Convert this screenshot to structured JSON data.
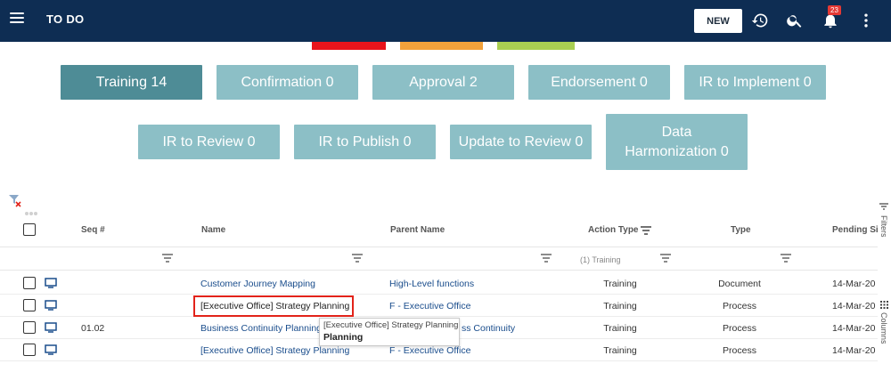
{
  "header": {
    "title": "TO DO",
    "new_button": "NEW",
    "notification_count": "23"
  },
  "status_colors": [
    "#e8141c",
    "#f2a23b",
    "#a9cf52"
  ],
  "tiles": {
    "row1": [
      "Training 14",
      "Confirmation 0",
      "Approval 2",
      "Endorsement 0",
      "IR to Implement 0"
    ],
    "row2": [
      "IR to Review 0",
      "IR to Publish 0",
      "Update to Review 0",
      "Data Harmonization 0"
    ]
  },
  "grid": {
    "columns": [
      "Seq #",
      "Name",
      "Parent Name",
      "Action Type",
      "Type",
      "Pending Sin"
    ],
    "action_type_filter": "(1) Training",
    "rows": [
      {
        "seq": "",
        "name": "Customer Journey Mapping",
        "parent": "High-Level functions",
        "action": "Training",
        "type": "Document",
        "pending": "14-Mar-20"
      },
      {
        "seq": "",
        "name": "[Executive Office] Strategy Planning",
        "parent": "F - Executive Office",
        "action": "Training",
        "type": "Process",
        "pending": "14-Mar-20"
      },
      {
        "seq": "01.02",
        "name": "Business Continuity Planning",
        "parent": "ss Continuity",
        "action": "Training",
        "type": "Process",
        "pending": "14-Mar-20"
      },
      {
        "seq": "",
        "name": "[Executive Office] Strategy Planning",
        "parent": "F - Executive Office",
        "action": "Training",
        "type": "Process",
        "pending": "14-Mar-20"
      }
    ]
  },
  "tooltip": {
    "line1": "[Executive Office] Strategy Planning",
    "line2": "Planning"
  },
  "side_panel": {
    "filters": "Filters",
    "columns": "Columns"
  },
  "colors": {
    "topbar": "#0e2d53",
    "tile": "#8cbfc6",
    "tile_active": "#4e8c96",
    "link": "#1a4d8c",
    "highlight": "#e2231a"
  }
}
